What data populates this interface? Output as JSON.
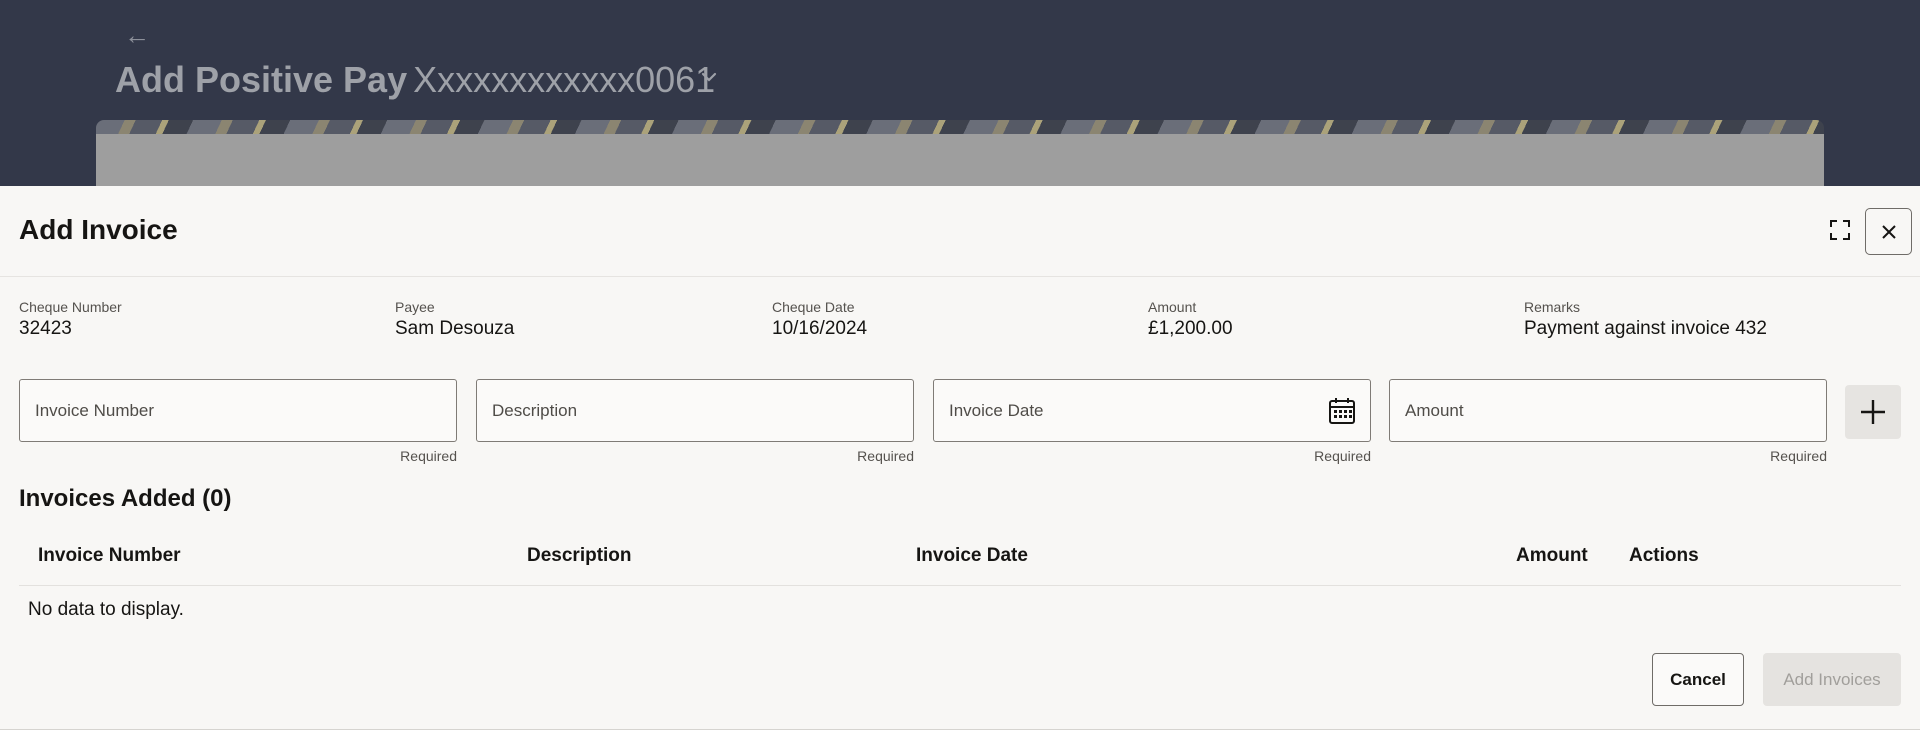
{
  "background": {
    "back_label": "←",
    "title_bold": "Add Positive Pay",
    "account": "Xxxxxxxxxxxx0061"
  },
  "modal": {
    "title": "Add Invoice",
    "summary": [
      {
        "label": "Cheque Number",
        "value": "32423"
      },
      {
        "label": "Payee",
        "value": "Sam Desouza"
      },
      {
        "label": "Cheque Date",
        "value": "10/16/2024"
      },
      {
        "label": "Amount",
        "value": "£1,200.00"
      },
      {
        "label": "Remarks",
        "value": "Payment against invoice 432"
      }
    ],
    "fields": [
      {
        "placeholder": "Invoice Number",
        "helper": "Required"
      },
      {
        "placeholder": "Description",
        "helper": "Required"
      },
      {
        "placeholder": "Invoice Date",
        "helper": "Required",
        "icon": "calendar-icon"
      },
      {
        "placeholder": "Amount",
        "helper": "Required"
      }
    ],
    "invoices_title": "Invoices Added (0)",
    "table": {
      "headers": [
        "Invoice Number",
        "Description",
        "Invoice Date",
        "Amount",
        "Actions"
      ],
      "empty_text": "No data to display."
    },
    "buttons": {
      "cancel": "Cancel",
      "submit": "Add Invoices"
    }
  },
  "colors": {
    "header_bg": "#333849",
    "sheet_bg": "#f8f7f5",
    "text": "#161513",
    "disabled_bg": "#e5e3e0"
  }
}
